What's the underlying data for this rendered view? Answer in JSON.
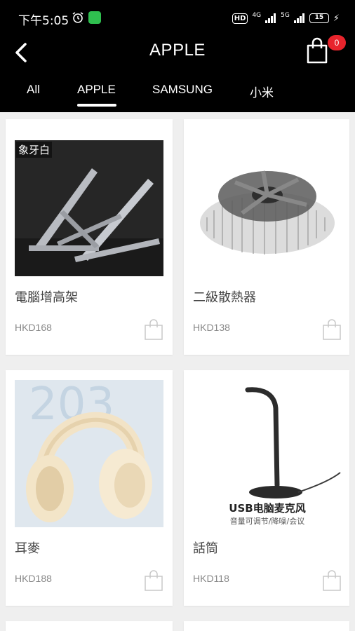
{
  "status_bar": {
    "time": "下午5:05",
    "hd": "HD",
    "net1": "4G",
    "net2": "5G",
    "battery": "15",
    "alarm_icon": "alarm-icon",
    "app_icon": "wechat-icon"
  },
  "header": {
    "title": "APPLE",
    "cart_count": "0",
    "back_icon": "chevron-left-icon",
    "cart_icon": "shopping-bag-icon"
  },
  "tabs": [
    {
      "label": "All"
    },
    {
      "label": "APPLE"
    },
    {
      "label": "SAMSUNG"
    },
    {
      "label": "小米"
    }
  ],
  "products": [
    {
      "name": "電腦增高架",
      "price": "HKD168",
      "image_tag": "象牙白",
      "image_type": "laptop-stand"
    },
    {
      "name": "二級散熱器",
      "price": "HKD138",
      "image_type": "cpu-cooler"
    },
    {
      "name": "耳麥",
      "price": "HKD188",
      "image_type": "headphones"
    },
    {
      "name": "話筒",
      "price": "HKD118",
      "image_type": "microphone",
      "image_caption": "USB电脑麦克风",
      "image_sub": "音量可调节/降噪/会议"
    }
  ],
  "colors": {
    "header_bg": "#000000",
    "page_bg": "#efefef",
    "badge": "#e8242c"
  }
}
